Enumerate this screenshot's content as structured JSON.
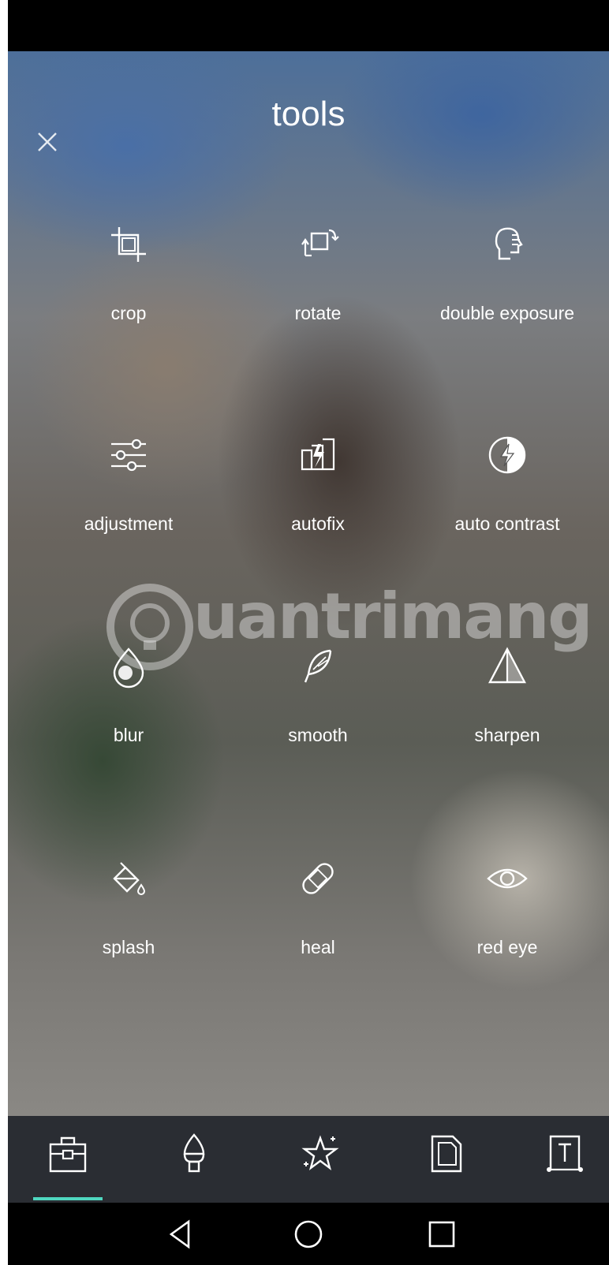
{
  "screen": {
    "title": "tools",
    "accent_color": "#4fd6c0",
    "close_icon": "close-icon"
  },
  "tools": [
    {
      "label": "crop",
      "icon": "crop-icon"
    },
    {
      "label": "rotate",
      "icon": "rotate-icon"
    },
    {
      "label": "double exposure",
      "icon": "double-exposure-icon"
    },
    {
      "label": "adjustment",
      "icon": "sliders-icon"
    },
    {
      "label": "autofix",
      "icon": "autofix-icon"
    },
    {
      "label": "auto contrast",
      "icon": "auto-contrast-icon"
    },
    {
      "label": "blur",
      "icon": "blur-drop-icon"
    },
    {
      "label": "smooth",
      "icon": "feather-icon"
    },
    {
      "label": "sharpen",
      "icon": "sharpen-triangle-icon"
    },
    {
      "label": "splash",
      "icon": "paint-bucket-icon"
    },
    {
      "label": "heal",
      "icon": "bandage-icon"
    },
    {
      "label": "red eye",
      "icon": "eye-icon"
    }
  ],
  "watermark": {
    "text": "uantrimang"
  },
  "bottom_tabs": [
    {
      "name": "tools",
      "icon": "toolbox-icon",
      "active": true
    },
    {
      "name": "effects",
      "icon": "brush-icon",
      "active": false
    },
    {
      "name": "stickers",
      "icon": "sparkle-star-icon",
      "active": false
    },
    {
      "name": "frames",
      "icon": "frame-icon",
      "active": false
    },
    {
      "name": "text",
      "icon": "text-box-icon",
      "active": false
    }
  ],
  "system_nav": [
    "back-icon",
    "home-icon",
    "recents-icon"
  ]
}
